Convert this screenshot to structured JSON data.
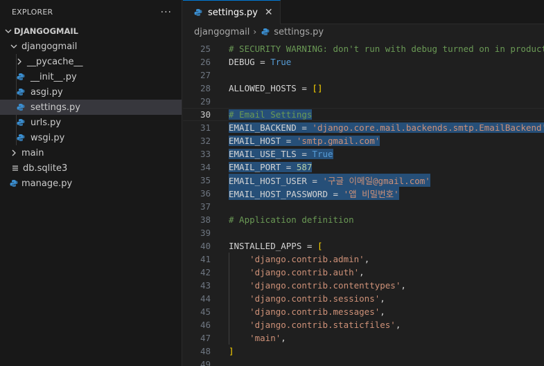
{
  "sidebar": {
    "title": "EXPLORER",
    "more": "···",
    "tree": [
      {
        "label": "DJANGOGMAIL",
        "kind": "root"
      },
      {
        "label": "djangogmail",
        "kind": "folder-open"
      },
      {
        "label": "__pycache__",
        "kind": "folder-closed"
      },
      {
        "label": "__init__.py",
        "kind": "py"
      },
      {
        "label": "asgi.py",
        "kind": "py"
      },
      {
        "label": "settings.py",
        "kind": "py"
      },
      {
        "label": "urls.py",
        "kind": "py"
      },
      {
        "label": "wsgi.py",
        "kind": "py"
      },
      {
        "label": "main",
        "kind": "folder-closed"
      },
      {
        "label": "db.sqlite3",
        "kind": "db"
      },
      {
        "label": "manage.py",
        "kind": "py"
      }
    ]
  },
  "editor": {
    "tab": {
      "label": "settings.py",
      "close": "✕"
    },
    "breadcrumb": {
      "folder": "djangogmail",
      "sep": "›",
      "file": "settings.py"
    },
    "current_line": "30",
    "lines": [
      {
        "n": "25",
        "tokens": [
          [
            "c-comment",
            "# SECURITY WARNING: don't run with debug turned on in production!"
          ]
        ]
      },
      {
        "n": "26",
        "tokens": [
          [
            "c-plain",
            "DEBUG = "
          ],
          [
            "c-kw",
            "True"
          ]
        ]
      },
      {
        "n": "27",
        "tokens": []
      },
      {
        "n": "28",
        "tokens": [
          [
            "c-plain",
            "ALLOWED_HOSTS = "
          ],
          [
            "c-bracket",
            "[]"
          ]
        ]
      },
      {
        "n": "29",
        "tokens": []
      },
      {
        "n": "30",
        "sel": true,
        "tokens": [
          [
            "c-comment",
            "# Email Settings"
          ]
        ]
      },
      {
        "n": "31",
        "sel": true,
        "tokens": [
          [
            "c-plain",
            "EMAIL_BACKEND = "
          ],
          [
            "c-str",
            "'django.core.mail.backends.smtp.EmailBackend'"
          ]
        ]
      },
      {
        "n": "32",
        "sel": true,
        "tokens": [
          [
            "c-plain",
            "EMAIL_HOST = "
          ],
          [
            "c-str",
            "'smtp.gmail.com'"
          ]
        ]
      },
      {
        "n": "33",
        "sel": true,
        "tokens": [
          [
            "c-plain",
            "EMAIL_USE_TLS = "
          ],
          [
            "c-kw",
            "True"
          ]
        ]
      },
      {
        "n": "34",
        "sel": true,
        "tokens": [
          [
            "c-plain",
            "EMAIL_PORT = "
          ],
          [
            "c-num",
            "587"
          ]
        ]
      },
      {
        "n": "35",
        "sel": true,
        "tokens": [
          [
            "c-plain",
            "EMAIL_HOST_USER = "
          ],
          [
            "c-str",
            "'구글 이메일@gmail.com'"
          ]
        ]
      },
      {
        "n": "36",
        "sel": true,
        "tokens": [
          [
            "c-plain",
            "EMAIL_HOST_PASSWORD = "
          ],
          [
            "c-str",
            "'앱 비밀번호'"
          ]
        ]
      },
      {
        "n": "37",
        "tokens": []
      },
      {
        "n": "38",
        "tokens": [
          [
            "c-comment",
            "# Application definition"
          ]
        ]
      },
      {
        "n": "39",
        "tokens": []
      },
      {
        "n": "40",
        "tokens": [
          [
            "c-plain",
            "INSTALLED_APPS = "
          ],
          [
            "c-bracket",
            "["
          ]
        ]
      },
      {
        "n": "41",
        "tokens": [
          [
            "c-plain",
            "    "
          ],
          [
            "c-str",
            "'django.contrib.admin'"
          ],
          [
            "c-plain",
            ","
          ]
        ]
      },
      {
        "n": "42",
        "tokens": [
          [
            "c-plain",
            "    "
          ],
          [
            "c-str",
            "'django.contrib.auth'"
          ],
          [
            "c-plain",
            ","
          ]
        ]
      },
      {
        "n": "43",
        "tokens": [
          [
            "c-plain",
            "    "
          ],
          [
            "c-str",
            "'django.contrib.contenttypes'"
          ],
          [
            "c-plain",
            ","
          ]
        ]
      },
      {
        "n": "44",
        "tokens": [
          [
            "c-plain",
            "    "
          ],
          [
            "c-str",
            "'django.contrib.sessions'"
          ],
          [
            "c-plain",
            ","
          ]
        ]
      },
      {
        "n": "45",
        "tokens": [
          [
            "c-plain",
            "    "
          ],
          [
            "c-str",
            "'django.contrib.messages'"
          ],
          [
            "c-plain",
            ","
          ]
        ]
      },
      {
        "n": "46",
        "tokens": [
          [
            "c-plain",
            "    "
          ],
          [
            "c-str",
            "'django.contrib.staticfiles'"
          ],
          [
            "c-plain",
            ","
          ]
        ]
      },
      {
        "n": "47",
        "tokens": [
          [
            "c-plain",
            "    "
          ],
          [
            "c-str",
            "'main'"
          ],
          [
            "c-plain",
            ","
          ]
        ]
      },
      {
        "n": "48",
        "tokens": [
          [
            "c-bracket",
            "]"
          ]
        ]
      },
      {
        "n": "49",
        "tokens": []
      }
    ]
  },
  "colors": {
    "python_icon": "#3b8fd1",
    "selection": "#264f78",
    "accent": "#0078d4"
  }
}
